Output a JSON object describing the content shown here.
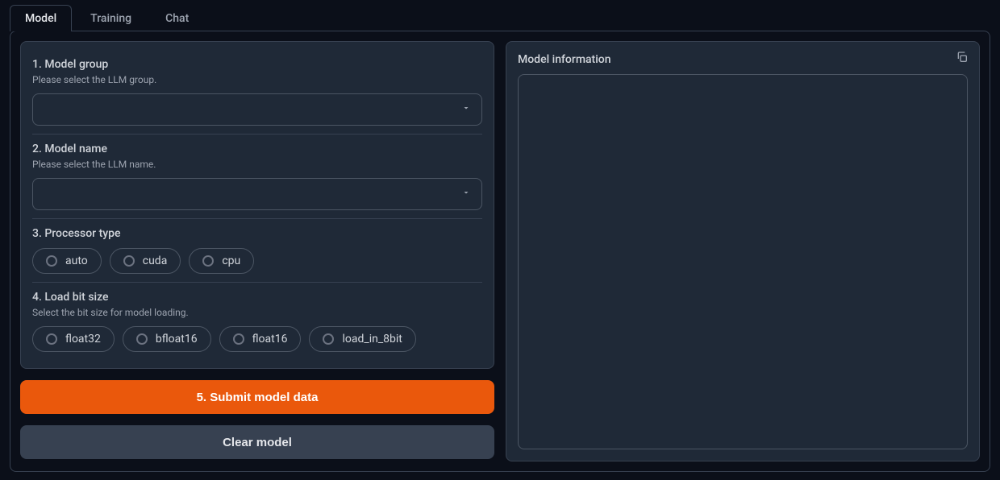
{
  "tabs": [
    {
      "label": "Model",
      "active": true
    },
    {
      "label": "Training",
      "active": false
    },
    {
      "label": "Chat",
      "active": false
    }
  ],
  "section1": {
    "title": "1. Model group",
    "desc": "Please select the LLM group.",
    "value": ""
  },
  "section2": {
    "title": "2. Model name",
    "desc": "Please select the LLM name.",
    "value": ""
  },
  "section3": {
    "title": "3. Processor type",
    "options": [
      "auto",
      "cuda",
      "cpu"
    ]
  },
  "section4": {
    "title": "4. Load bit size",
    "desc": "Select the bit size for model loading.",
    "options": [
      "float32",
      "bfloat16",
      "float16",
      "load_in_8bit"
    ]
  },
  "buttons": {
    "submit": "5. Submit model data",
    "clear": "Clear model"
  },
  "info": {
    "title": "Model information",
    "value": ""
  }
}
